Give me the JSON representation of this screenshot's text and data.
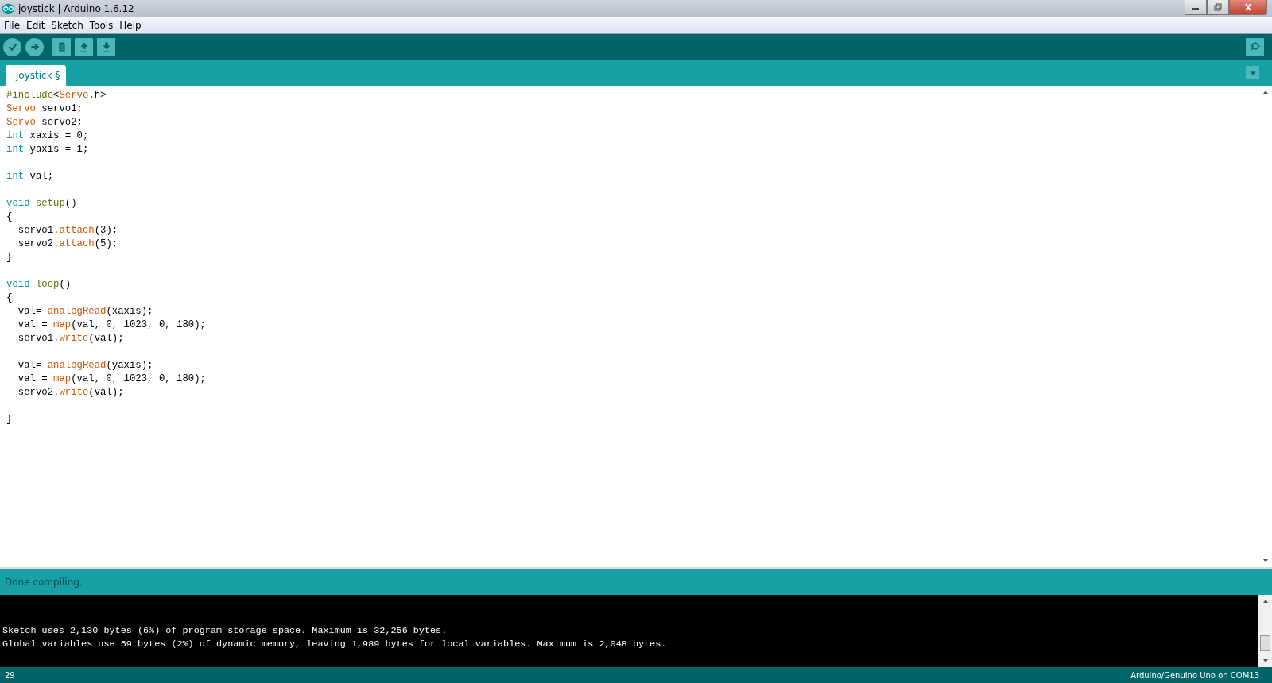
{
  "window": {
    "title": "joystick | Arduino 1.6.12"
  },
  "menu": [
    "File",
    "Edit",
    "Sketch",
    "Tools",
    "Help"
  ],
  "tabs": [
    {
      "label": "joystick §",
      "selected": true
    }
  ],
  "editor": {
    "blocks": [
      {
        "lines": [
          [
            {
              "text": "#include",
              "kind": "preprocessor"
            },
            {
              "text": "<",
              "kind": "plain"
            },
            {
              "text": "Servo",
              "kind": "builtin"
            },
            {
              "text": ".h>",
              "kind": "plain"
            }
          ],
          [
            {
              "text": "Servo",
              "kind": "builtin"
            },
            {
              "text": " servo1;",
              "kind": "plain"
            }
          ],
          [
            {
              "text": "Servo",
              "kind": "builtin"
            },
            {
              "text": " servo2;",
              "kind": "plain"
            }
          ],
          [
            {
              "text": "int",
              "kind": "keyword"
            },
            {
              "text": " xaxis = 0;",
              "kind": "plain"
            }
          ],
          [
            {
              "text": "int",
              "kind": "keyword"
            },
            {
              "text": " yaxis = 1;",
              "kind": "plain"
            }
          ]
        ]
      },
      {
        "lines": [
          [
            {
              "text": "int",
              "kind": "keyword"
            },
            {
              "text": " val;",
              "kind": "plain"
            }
          ]
        ]
      },
      {
        "lines": [
          [
            {
              "text": "void",
              "kind": "keyword"
            },
            {
              "text": " setup",
              "kind": "function"
            },
            {
              "text": "()",
              "kind": "plain"
            }
          ],
          [
            {
              "text": "{",
              "kind": "plain"
            }
          ],
          [
            {
              "text": "  servo1.",
              "kind": "plain"
            },
            {
              "text": "attach",
              "kind": "builtin"
            },
            {
              "text": "(3);",
              "kind": "plain"
            }
          ],
          [
            {
              "text": "  servo2.",
              "kind": "plain"
            },
            {
              "text": "attach",
              "kind": "builtin"
            },
            {
              "text": "(5);",
              "kind": "plain"
            }
          ],
          [
            {
              "text": "}",
              "kind": "plain"
            }
          ]
        ]
      },
      {
        "lines": [
          [
            {
              "text": "void",
              "kind": "keyword"
            },
            {
              "text": " loop",
              "kind": "function"
            },
            {
              "text": "()",
              "kind": "plain"
            }
          ],
          [
            {
              "text": "{",
              "kind": "plain"
            }
          ],
          [
            {
              "text": "  val= ",
              "kind": "plain"
            },
            {
              "text": "analogRead",
              "kind": "builtin"
            },
            {
              "text": "(xaxis);",
              "kind": "plain"
            }
          ],
          [
            {
              "text": "  val = ",
              "kind": "plain"
            },
            {
              "text": "map",
              "kind": "builtin"
            },
            {
              "text": "(val, 0, 1023, 0, 180);",
              "kind": "plain"
            }
          ],
          [
            {
              "text": "  servo1.",
              "kind": "plain"
            },
            {
              "text": "write",
              "kind": "builtin"
            },
            {
              "text": "(val);",
              "kind": "plain"
            }
          ]
        ]
      },
      {
        "lines": [
          [
            {
              "text": "  val= ",
              "kind": "plain"
            },
            {
              "text": "analogRead",
              "kind": "builtin"
            },
            {
              "text": "(yaxis);",
              "kind": "plain"
            }
          ],
          [
            {
              "text": "  val = ",
              "kind": "plain"
            },
            {
              "text": "map",
              "kind": "builtin"
            },
            {
              "text": "(val, 0, 1023, 0, 180);",
              "kind": "plain"
            }
          ],
          [
            {
              "text": "  servo2.",
              "kind": "plain"
            },
            {
              "text": "write",
              "kind": "builtin"
            },
            {
              "text": "(val);",
              "kind": "plain"
            }
          ]
        ]
      },
      {
        "lines": [
          [
            {
              "text": "}",
              "kind": "plain"
            }
          ]
        ]
      }
    ]
  },
  "status_message": "Done compiling.",
  "console": [
    "Sketch uses 2,130 bytes (6%) of program storage space. Maximum is 32,256 bytes.",
    "Global variables use 59 bytes (2%) of dynamic memory, leaving 1,989 bytes for local variables. Maximum is 2,048 bytes."
  ],
  "status_bar": {
    "line": "29",
    "board": "Arduino/Genuino Uno on COM13"
  }
}
